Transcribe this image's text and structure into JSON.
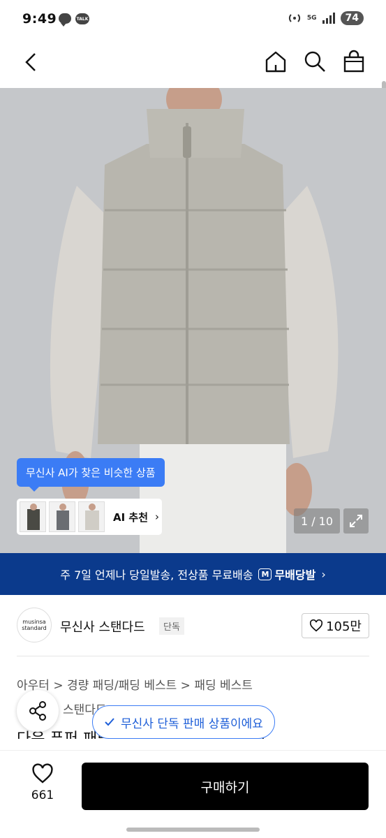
{
  "status_bar": {
    "time": "9:49",
    "talk_label": "TALK",
    "network": "5G",
    "battery": "74"
  },
  "nav": {
    "icons": [
      "back-icon",
      "home-icon",
      "search-icon",
      "bag-icon"
    ]
  },
  "hero": {
    "ai_tooltip": "무신사 AI가 찾은 비슷한 상품",
    "ai_recommend_label": "AI 추천",
    "ai_recommend_chevron": "›",
    "pager": "1 / 10"
  },
  "shipping_banner": {
    "text": "주 7일 언제나 당일발송, 전상품 무료배송",
    "badge_mark": "M",
    "badge_label": "무배당발",
    "chevron": "›"
  },
  "brand": {
    "logo_line1": "musinsa",
    "logo_line2": "standard",
    "name": "무신사 스탠다드",
    "tag": "단독",
    "likes": "105만"
  },
  "product": {
    "breadcrumb": "아우터 > 경량 패딩/패딩 베스트 > 패딩 베스트",
    "brand_sub": "스탠다드",
    "title": "다운 푸퍼 패딩 베스트 [라이트 베이지]"
  },
  "toast": {
    "exclusive": "무신사 단독 판매 상품이에요"
  },
  "action_bar": {
    "wish_count": "661",
    "buy_label": "구매하기"
  },
  "colors": {
    "banner_bg": "#0b3a8c",
    "accent_blue": "#3b7cf5",
    "buy_bg": "#000000"
  }
}
